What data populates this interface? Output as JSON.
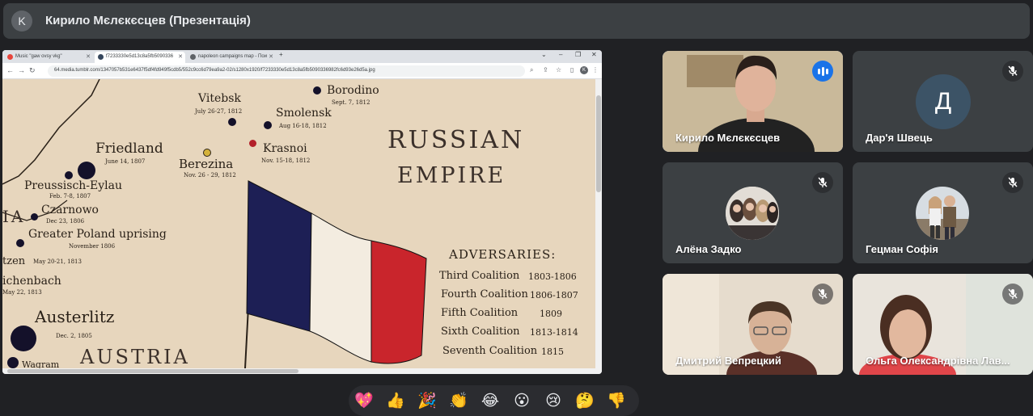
{
  "header": {
    "avatar_letter": "K",
    "title": "Кирило Мєлєкєсцев (Презентація)"
  },
  "browser": {
    "tabs": [
      {
        "label": "Music \"gaw ovsy vkg\"",
        "icon": "music-icon",
        "color": "#e8453c"
      },
      {
        "label": "f7233330e5d13c8a5fb5090336",
        "icon": "tumblr-icon",
        "color": "#35465c"
      },
      {
        "label": "napoleon campaigns map - Пои",
        "icon": "google-icon",
        "color": "#5f6368"
      }
    ],
    "new_tab": "+",
    "url": "64.media.tumblr.com/1347057b531e6437f5df4fd949f5cdb5/552c9cc6d79ea9a2-02/s1280x1920/f7233330e5d13c8a5fb5090336982fc6d93e26d5a.jpg"
  },
  "map": {
    "places": [
      {
        "name": "Borodino",
        "date": "Sept. 7, 1812"
      },
      {
        "name": "Vitebsk",
        "date": "July 26-27, 1812"
      },
      {
        "name": "Smolensk",
        "date": "Aug 16-18, 1812"
      },
      {
        "name": "Krasnoi",
        "date": "Nov. 15-18, 1812"
      },
      {
        "name": "Friedland",
        "date": "June 14, 1807"
      },
      {
        "name": "Berezina",
        "date": "Nov. 26 - 29, 1812"
      },
      {
        "name": "Preussisch-Eylau",
        "date": "Feb. 7-8, 1807"
      },
      {
        "name": "Czarnowo",
        "date": "Dec 23, 1806"
      },
      {
        "name": "Greater Poland uprising",
        "date": "November 1806"
      },
      {
        "name": "tzen",
        "date": "May 20-21, 1813"
      },
      {
        "name": "ichenbach",
        "date": "May 22, 1813"
      },
      {
        "name": "Austerlitz",
        "date": "Dec. 2, 1805"
      },
      {
        "name": "Wagram",
        "date": ""
      }
    ],
    "region_russia_1": "RUSSIAN",
    "region_russia_2": "EMPIRE",
    "region_austria": "AUSTRIA",
    "region_edge": "IA",
    "adversaries_title": "ADVERSARIES:",
    "coalitions": [
      {
        "name": "Third Coalition",
        "years": "1803-1806"
      },
      {
        "name": "Fourth Coalition",
        "years": "1806-1807"
      },
      {
        "name": "Fifth Coalition",
        "years": "1809"
      },
      {
        "name": "Sixth Coalition",
        "years": "1813-1814"
      },
      {
        "name": "Seventh Coalition",
        "years": "1815"
      }
    ],
    "flag_colors": [
      "#1d1f55",
      "#f3ece0",
      "#c9252c"
    ]
  },
  "participants": [
    {
      "name": "Кирило Мєлєкєсцев",
      "speaking": true
    },
    {
      "name": "Дар'я Швець",
      "avatar_letter": "Д",
      "avatar_color": "#3c5366",
      "muted": true
    },
    {
      "name": "Алёна Задко",
      "muted": true
    },
    {
      "name": "Гецман Софія",
      "muted": true
    },
    {
      "name": "Дмитрий Вепрецкий",
      "muted": true
    },
    {
      "name": "Ольга Олександрівна Лав...",
      "muted": true
    }
  ],
  "reactions": [
    {
      "emoji": "💖",
      "icon": "sparkling-heart-icon"
    },
    {
      "emoji": "👍",
      "icon": "thumbs-up-icon"
    },
    {
      "emoji": "🎉",
      "icon": "party-popper-icon"
    },
    {
      "emoji": "👏",
      "icon": "clapping-hands-icon"
    },
    {
      "emoji": "😂",
      "icon": "tears-of-joy-icon"
    },
    {
      "emoji": "😮",
      "icon": "surprised-face-icon"
    },
    {
      "emoji": "😢",
      "icon": "crying-face-icon"
    },
    {
      "emoji": "🤔",
      "icon": "thinking-face-icon"
    },
    {
      "emoji": "👎",
      "icon": "thumbs-down-icon"
    }
  ]
}
